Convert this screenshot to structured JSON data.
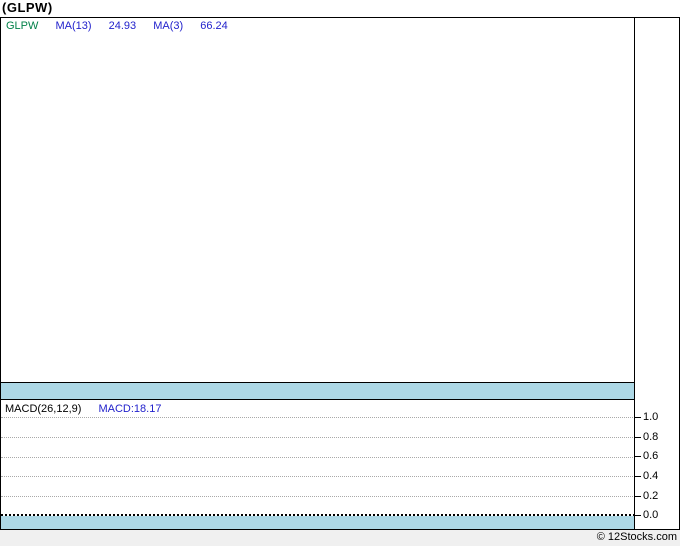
{
  "page": {
    "title": "(GLPW)",
    "footer_credit": "© 12Stocks.com"
  },
  "colors": {
    "symbol": "#008048",
    "value": "#2222cc",
    "band": "#add8e6",
    "footer-bg": "#f0f0f0"
  },
  "main_chart": {
    "legend": {
      "symbol": "GLPW",
      "ma1_label": "MA(13)",
      "ma1_value": "24.93",
      "ma2_label": "MA(3)",
      "ma2_value": "66.24"
    }
  },
  "macd_panel": {
    "legend_label": "MACD(26,12,9)",
    "legend_value": "MACD:18.17",
    "axis_ticks": [
      "1.0",
      "0.8",
      "0.6",
      "0.4",
      "0.2",
      "0.0"
    ]
  },
  "chart_data": [
    {
      "type": "line",
      "title": "(GLPW)",
      "panel": "price",
      "series": [
        {
          "name": "GLPW",
          "values": []
        },
        {
          "name": "MA(13)",
          "legend_value": 24.93,
          "values": []
        },
        {
          "name": "MA(3)",
          "legend_value": 66.24,
          "values": []
        }
      ],
      "legend_position": "top-left",
      "grid": false
    },
    {
      "type": "line",
      "title": "MACD(26,12,9)",
      "panel": "macd",
      "series": [
        {
          "name": "MACD",
          "legend_value": 18.17,
          "values": []
        }
      ],
      "ylim": [
        0.0,
        1.0
      ],
      "yticks": [
        1.0,
        0.8,
        0.6,
        0.4,
        0.2,
        0.0
      ],
      "yaxis_position": "right",
      "grid": true,
      "legend_position": "top-left"
    }
  ]
}
